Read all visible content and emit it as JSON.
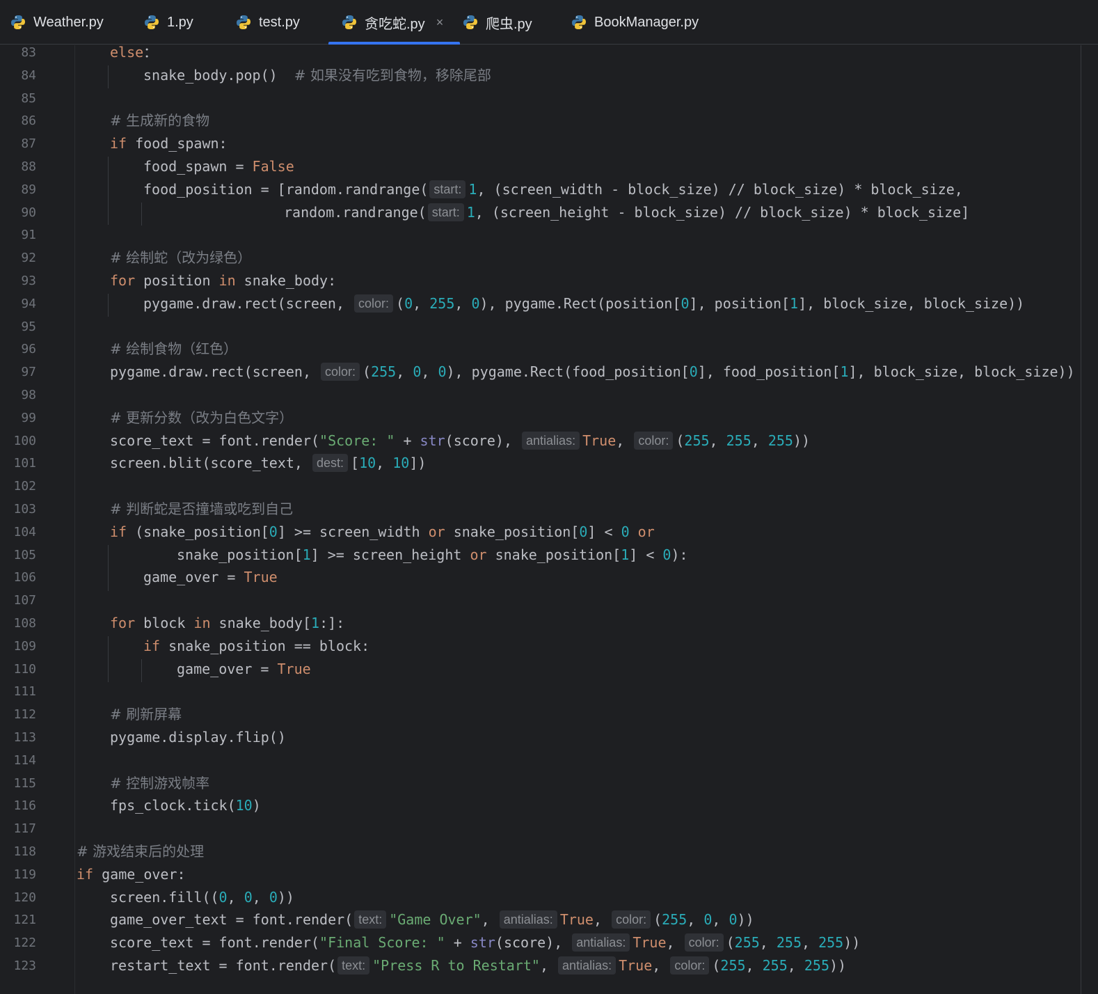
{
  "tabs": [
    {
      "label": "Weather.py",
      "active": false
    },
    {
      "label": "1.py",
      "active": false
    },
    {
      "label": "test.py",
      "active": false
    },
    {
      "label": "贪吃蛇.py",
      "active": true,
      "close": "×"
    },
    {
      "label": "爬虫.py",
      "active": false
    },
    {
      "label": "BookManager.py",
      "active": false
    }
  ],
  "colors": {
    "background": "#1e1f22",
    "keyword": "#cf8e6d",
    "number": "#2aacb8",
    "string": "#6aab73",
    "comment": "#7a7e85",
    "active_tab_underline": "#3574f0"
  },
  "lines": [
    {
      "n": "83",
      "t": [
        [
          "kw",
          "else"
        ],
        [
          "",
          "："
        ]
      ]
    },
    {
      "n": "84",
      "t": [
        [
          "",
          "snake_body.pop()  "
        ],
        [
          "cm",
          "# 如果没有吃到食物，移除尾部"
        ]
      ]
    },
    {
      "n": "85",
      "t": []
    },
    {
      "n": "86",
      "t": [
        [
          "cm",
          "# 生成新的食物"
        ]
      ]
    },
    {
      "n": "87",
      "t": [
        [
          "kw",
          "if"
        ],
        [
          "",
          " food_spawn:"
        ]
      ]
    },
    {
      "n": "88",
      "t": [
        [
          "",
          "food_spawn = "
        ],
        [
          "kw",
          "False"
        ]
      ]
    },
    {
      "n": "89",
      "t": [
        [
          "",
          "food_position = [random.randrange("
        ],
        [
          "hint",
          "start:"
        ],
        [
          "num",
          "1"
        ],
        [
          "",
          ", (screen_width - block_size) // block_size) * block_size,"
        ]
      ]
    },
    {
      "n": "90",
      "t": [
        [
          "",
          "random.randrange("
        ],
        [
          "hint",
          "start:"
        ],
        [
          "num",
          "1"
        ],
        [
          "",
          ", (screen_height - block_size) // block_size) * block_size]"
        ]
      ]
    },
    {
      "n": "91",
      "t": []
    },
    {
      "n": "92",
      "t": [
        [
          "cm",
          "# 绘制蛇（改为绿色）"
        ]
      ]
    },
    {
      "n": "93",
      "t": [
        [
          "kw",
          "for"
        ],
        [
          "",
          " position "
        ],
        [
          "kw",
          "in"
        ],
        [
          "",
          " snake_body:"
        ]
      ]
    },
    {
      "n": "94",
      "t": [
        [
          "",
          "pygame.draw.rect(screen, "
        ],
        [
          "hint",
          "color:"
        ],
        [
          "",
          "("
        ],
        [
          "num",
          "0"
        ],
        [
          "",
          ", "
        ],
        [
          "num",
          "255"
        ],
        [
          "",
          ", "
        ],
        [
          "num",
          "0"
        ],
        [
          "",
          "), pygame.Rect(position["
        ],
        [
          "num",
          "0"
        ],
        [
          "",
          "], position["
        ],
        [
          "num",
          "1"
        ],
        [
          "",
          "], block_size, block_size))"
        ]
      ]
    },
    {
      "n": "95",
      "t": []
    },
    {
      "n": "96",
      "t": [
        [
          "cm",
          "# 绘制食物（红色）"
        ]
      ]
    },
    {
      "n": "97",
      "t": [
        [
          "",
          "pygame.draw.rect(screen, "
        ],
        [
          "hint",
          "color:"
        ],
        [
          "",
          "("
        ],
        [
          "num",
          "255"
        ],
        [
          "",
          ", "
        ],
        [
          "num",
          "0"
        ],
        [
          "",
          ", "
        ],
        [
          "num",
          "0"
        ],
        [
          "",
          "), pygame.Rect(food_position["
        ],
        [
          "num",
          "0"
        ],
        [
          "",
          "], food_position["
        ],
        [
          "num",
          "1"
        ],
        [
          "",
          "], block_size, block_size))"
        ]
      ]
    },
    {
      "n": "98",
      "t": []
    },
    {
      "n": "99",
      "t": [
        [
          "cm",
          "# 更新分数（改为白色文字）"
        ]
      ]
    },
    {
      "n": "100",
      "t": [
        [
          "",
          "score_text = font.render("
        ],
        [
          "str",
          "\"Score: \""
        ],
        [
          "",
          " + "
        ],
        [
          "bi",
          "str"
        ],
        [
          "",
          "(score), "
        ],
        [
          "hint",
          "antialias:"
        ],
        [
          "kw",
          "True"
        ],
        [
          "",
          ", "
        ],
        [
          "hint",
          "color:"
        ],
        [
          "",
          "("
        ],
        [
          "num",
          "255"
        ],
        [
          "",
          ", "
        ],
        [
          "num",
          "255"
        ],
        [
          "",
          ", "
        ],
        [
          "num",
          "255"
        ],
        [
          "",
          "))"
        ]
      ]
    },
    {
      "n": "101",
      "t": [
        [
          "",
          "screen.blit(score_text, "
        ],
        [
          "hint",
          "dest:"
        ],
        [
          "",
          "["
        ],
        [
          "num",
          "10"
        ],
        [
          "",
          ", "
        ],
        [
          "num",
          "10"
        ],
        [
          "",
          "])"
        ]
      ]
    },
    {
      "n": "102",
      "t": []
    },
    {
      "n": "103",
      "t": [
        [
          "cm",
          "# 判断蛇是否撞墙或吃到自己"
        ]
      ]
    },
    {
      "n": "104",
      "t": [
        [
          "kw",
          "if"
        ],
        [
          "",
          " (snake_position["
        ],
        [
          "num",
          "0"
        ],
        [
          "",
          "] >= screen_width "
        ],
        [
          "kw",
          "or"
        ],
        [
          "",
          " snake_position["
        ],
        [
          "num",
          "0"
        ],
        [
          "",
          "] < "
        ],
        [
          "num",
          "0"
        ],
        [
          "kw",
          " or"
        ]
      ]
    },
    {
      "n": "105",
      "t": [
        [
          "",
          "snake_position["
        ],
        [
          "num",
          "1"
        ],
        [
          "",
          "] >= screen_height "
        ],
        [
          "kw",
          "or"
        ],
        [
          "",
          " snake_position["
        ],
        [
          "num",
          "1"
        ],
        [
          "",
          "] < "
        ],
        [
          "num",
          "0"
        ],
        [
          "",
          "):"
        ]
      ]
    },
    {
      "n": "106",
      "t": [
        [
          "",
          "game_over = "
        ],
        [
          "kw",
          "True"
        ]
      ]
    },
    {
      "n": "107",
      "t": []
    },
    {
      "n": "108",
      "t": [
        [
          "kw",
          "for"
        ],
        [
          "",
          " block "
        ],
        [
          "kw",
          "in"
        ],
        [
          "",
          " snake_body["
        ],
        [
          "num",
          "1"
        ],
        [
          "",
          ":]:"
        ]
      ]
    },
    {
      "n": "109",
      "t": [
        [
          "kw",
          "if"
        ],
        [
          "",
          " snake_position == block:"
        ]
      ]
    },
    {
      "n": "110",
      "t": [
        [
          "",
          "game_over = "
        ],
        [
          "kw",
          "True"
        ]
      ]
    },
    {
      "n": "111",
      "t": []
    },
    {
      "n": "112",
      "t": [
        [
          "cm",
          "# 刷新屏幕"
        ]
      ]
    },
    {
      "n": "113",
      "t": [
        [
          "",
          "pygame.display.flip()"
        ]
      ]
    },
    {
      "n": "114",
      "t": []
    },
    {
      "n": "115",
      "t": [
        [
          "cm",
          "# 控制游戏帧率"
        ]
      ]
    },
    {
      "n": "116",
      "t": [
        [
          "",
          "fps_clock.tick("
        ],
        [
          "num",
          "10"
        ],
        [
          "",
          ")"
        ]
      ]
    },
    {
      "n": "117",
      "t": []
    },
    {
      "n": "118",
      "t": [
        [
          "cm",
          "# 游戏结束后的处理"
        ]
      ]
    },
    {
      "n": "119",
      "t": [
        [
          "kw",
          "if"
        ],
        [
          "",
          " game_over:"
        ]
      ]
    },
    {
      "n": "120",
      "t": [
        [
          "",
          "screen.fill(("
        ],
        [
          "num",
          "0"
        ],
        [
          "",
          ", "
        ],
        [
          "num",
          "0"
        ],
        [
          "",
          ", "
        ],
        [
          "num",
          "0"
        ],
        [
          "",
          "))"
        ]
      ]
    },
    {
      "n": "121",
      "t": [
        [
          "",
          "game_over_text = font.render("
        ],
        [
          "hint",
          "text:"
        ],
        [
          "str",
          "\"Game Over\""
        ],
        [
          "",
          ", "
        ],
        [
          "hint",
          "antialias:"
        ],
        [
          "kw",
          "True"
        ],
        [
          "",
          ", "
        ],
        [
          "hint",
          "color:"
        ],
        [
          "",
          "("
        ],
        [
          "num",
          "255"
        ],
        [
          "",
          ", "
        ],
        [
          "num",
          "0"
        ],
        [
          "",
          ", "
        ],
        [
          "num",
          "0"
        ],
        [
          "",
          "))"
        ]
      ]
    },
    {
      "n": "122",
      "t": [
        [
          "",
          "score_text = font.render("
        ],
        [
          "str",
          "\"Final Score: \""
        ],
        [
          "",
          " + "
        ],
        [
          "bi",
          "str"
        ],
        [
          "",
          "(score), "
        ],
        [
          "hint",
          "antialias:"
        ],
        [
          "kw",
          "True"
        ],
        [
          "",
          ", "
        ],
        [
          "hint",
          "color:"
        ],
        [
          "",
          "("
        ],
        [
          "num",
          "255"
        ],
        [
          "",
          ", "
        ],
        [
          "num",
          "255"
        ],
        [
          "",
          ", "
        ],
        [
          "num",
          "255"
        ],
        [
          "",
          "))"
        ]
      ]
    },
    {
      "n": "123",
      "t": [
        [
          "",
          "restart_text = font.render("
        ],
        [
          "hint",
          "text:"
        ],
        [
          "str",
          "\"Press R to Restart\""
        ],
        [
          "",
          ", "
        ],
        [
          "hint",
          "antialias:"
        ],
        [
          "kw",
          "True"
        ],
        [
          "",
          ", "
        ],
        [
          "hint",
          "color:"
        ],
        [
          "",
          "("
        ],
        [
          "num",
          "255"
        ],
        [
          "",
          ", "
        ],
        [
          "num",
          "255"
        ],
        [
          "",
          ", "
        ],
        [
          "num",
          "255"
        ],
        [
          "",
          "))"
        ]
      ]
    }
  ]
}
